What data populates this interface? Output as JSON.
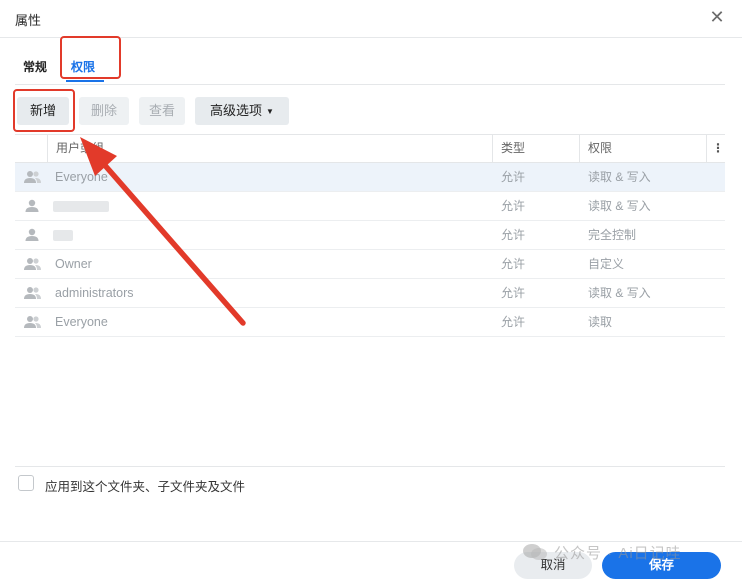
{
  "dialog": {
    "title": "属性"
  },
  "tabs": [
    {
      "label": "常规",
      "active": false
    },
    {
      "label": "权限",
      "active": true
    }
  ],
  "toolbar": {
    "add": "新增",
    "delete": "删除",
    "view": "查看",
    "advanced": "高级选项"
  },
  "table": {
    "columns": [
      "用户或组",
      "类型",
      "权限"
    ],
    "rows": [
      {
        "icon": "group-icon",
        "name": "Everyone",
        "type": "允许",
        "permission": "读取 & 写入",
        "selected": true
      },
      {
        "icon": "user-icon",
        "name": "",
        "type": "允许",
        "permission": "读取 & 写入"
      },
      {
        "icon": "user-icon",
        "name": "",
        "type": "允许",
        "permission": "完全控制"
      },
      {
        "icon": "group-icon",
        "name": "Owner",
        "type": "允许",
        "permission": "自定义"
      },
      {
        "icon": "group-icon",
        "name": "administrators",
        "type": "允许",
        "permission": "读取 & 写入"
      },
      {
        "icon": "group-icon",
        "name": "Everyone",
        "type": "允许",
        "permission": "读取"
      }
    ]
  },
  "apply": {
    "label": "应用到这个文件夹、子文件夹及文件",
    "checked": false
  },
  "footer": {
    "cancel": "取消",
    "save": "保存"
  },
  "watermark": {
    "text": "公众号 · Ai日记哇"
  },
  "colors": {
    "accent": "#1a73e8",
    "annotation": "#e23a2a"
  }
}
